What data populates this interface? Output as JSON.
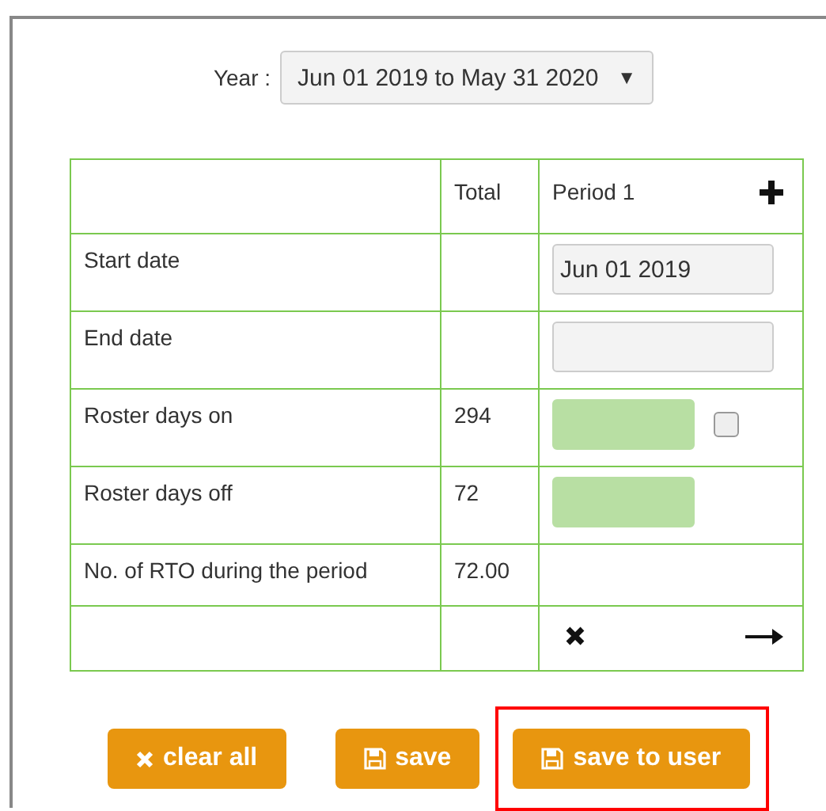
{
  "year": {
    "label": "Year :",
    "value": "Jun 01 2019 to May 31 2020",
    "caret": "▼"
  },
  "table": {
    "columns": [
      "Total",
      "Period 1"
    ],
    "rows": [
      {
        "label": "Start date",
        "total": "",
        "kind": "input",
        "value": "Jun 01 2019",
        "filled": false
      },
      {
        "label": "End date",
        "total": "",
        "kind": "input",
        "value": "",
        "filled": false
      },
      {
        "label": "Roster days on",
        "total": "294",
        "kind": "input",
        "value": "",
        "filled": true,
        "checkbox": {
          "checked": false
        }
      },
      {
        "label": "Roster days off",
        "total": "72",
        "kind": "input",
        "value": "",
        "filled": true
      },
      {
        "label": "No. of RTO during the period",
        "total": "72.00",
        "kind": "empty"
      }
    ]
  },
  "buttons": [
    {
      "label": "clear all",
      "kind": "clear",
      "highlighted": false
    },
    {
      "label": "save",
      "kind": "save",
      "highlighted": false
    },
    {
      "label": "save to user",
      "kind": "save",
      "highlighted": true
    }
  ]
}
